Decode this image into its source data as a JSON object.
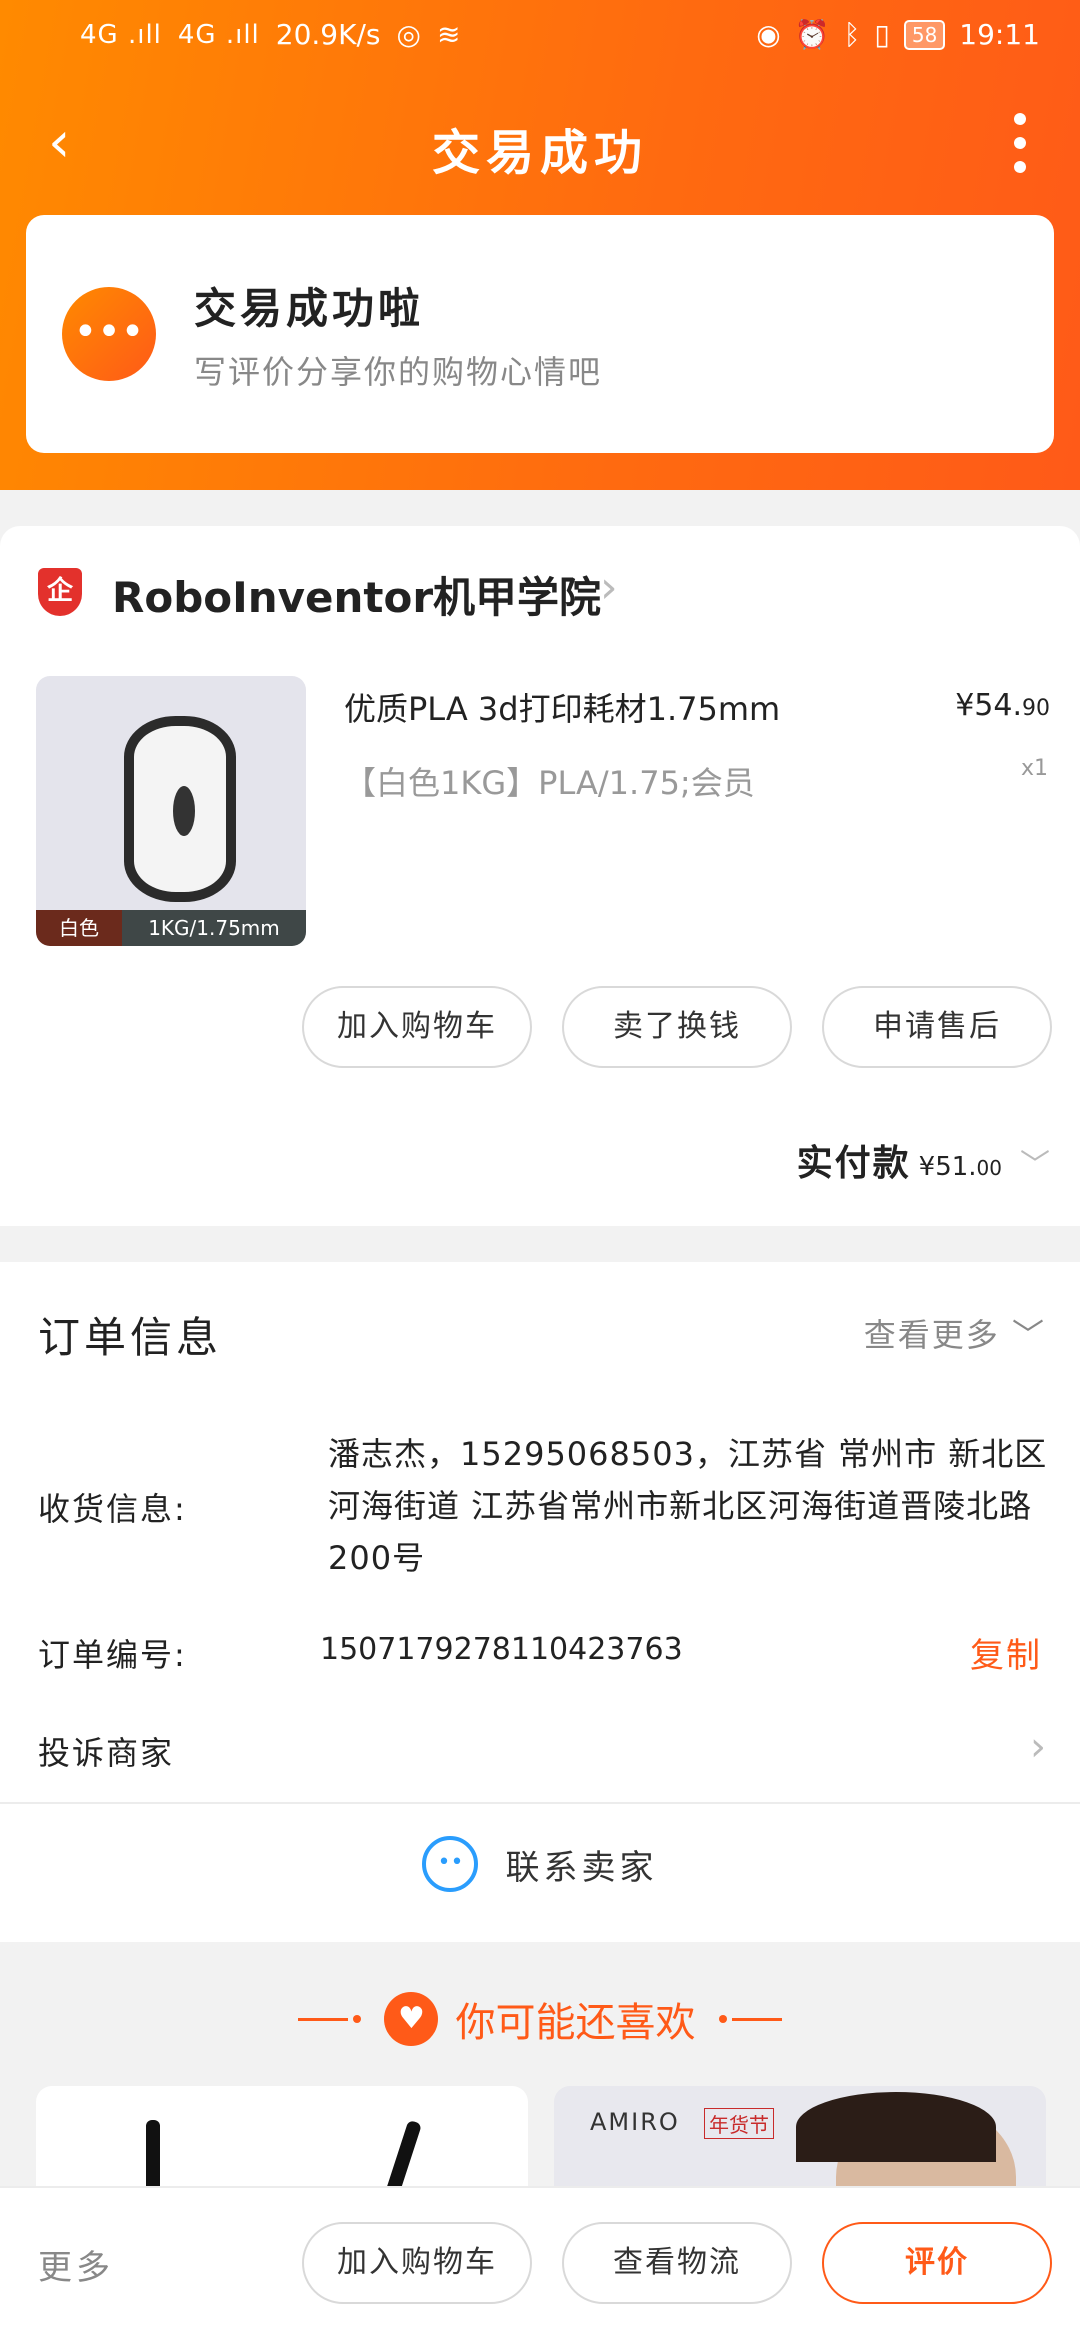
{
  "status_bar": {
    "signal1": "4G .ıll",
    "signal2": "4G .ıll",
    "speed": "20.9K/s",
    "battery": "58",
    "time": "19:11",
    "icons": [
      "nfc-icon",
      "wifi-icon",
      "eye-icon",
      "alarm-icon",
      "bluetooth-icon",
      "vibrate-icon"
    ]
  },
  "header": {
    "title": "交易成功"
  },
  "success": {
    "title": "交易成功啦",
    "subtitle": "写评价分享你的购物心情吧"
  },
  "shop": {
    "badge": "企",
    "name": "RoboInventor机甲学院"
  },
  "product": {
    "title": "优质PLA 3d打印耗材1.75mm",
    "spec": "【白色1KG】PLA/1.75;会员",
    "price_main": "¥54.",
    "price_cents": "90",
    "quantity": "x1",
    "image_tag_color": "白色",
    "image_tag_size": "1KG/1.75mm"
  },
  "item_actions": {
    "add_cart": "加入购物车",
    "sell": "卖了换钱",
    "after_sale": "申请售后"
  },
  "payment": {
    "label": "实付款",
    "amount_main": "¥51.",
    "amount_cents": "00"
  },
  "order": {
    "title": "订单信息",
    "more": "查看更多",
    "shipping_label": "收货信息:",
    "shipping_value": "潘志杰，15295068503，江苏省 常州市 新北区   河海街道 江苏省常州市新北区河海街道晋陵北路200号",
    "number_label": "订单编号:",
    "number_value": "1507179278110423763",
    "copy": "复制",
    "complain": "投诉商家",
    "contact": "联系卖家"
  },
  "recommend": {
    "title": "你可能还喜欢",
    "brand": "AMIRO",
    "brand_tag": "年货节"
  },
  "bottom_bar": {
    "more": "更多",
    "add_cart": "加入购物车",
    "logistics": "查看物流",
    "review": "评价"
  },
  "colors": {
    "accent": "#ff5a18",
    "header_start": "#ff8a00",
    "contact_blue": "#2a9dfd"
  }
}
